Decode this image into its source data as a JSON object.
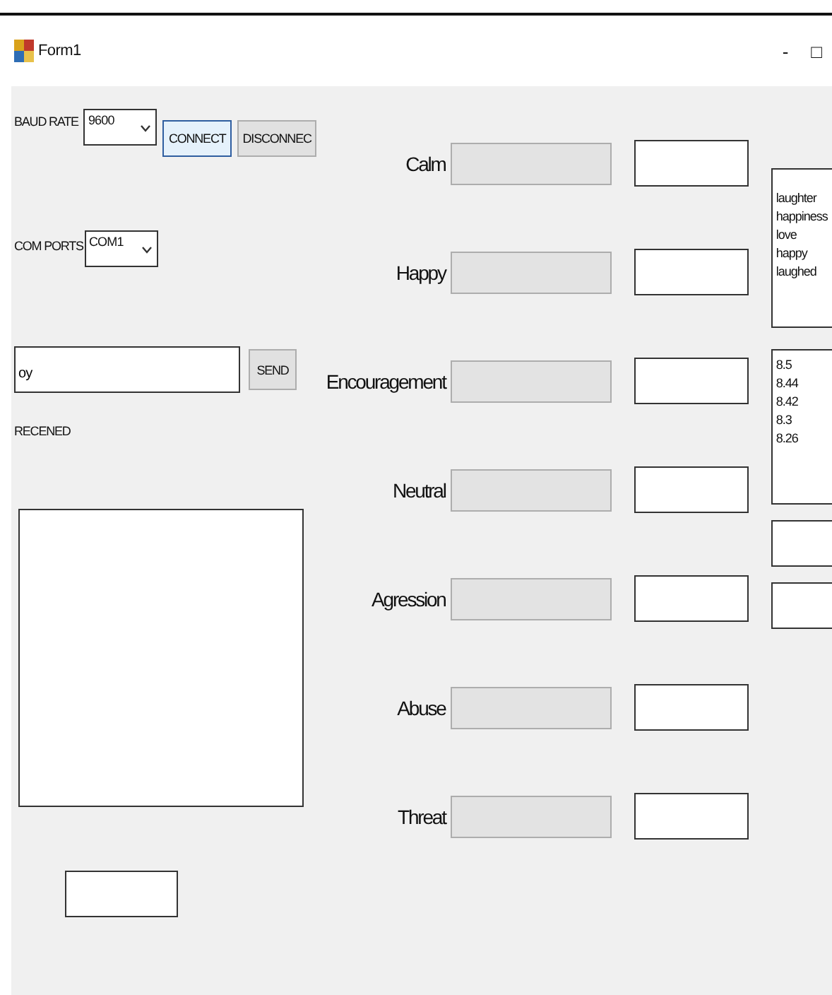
{
  "window": {
    "title": "Form1",
    "minimize": "-",
    "maximize": "□"
  },
  "baud_rate": {
    "label": "BAUD RATE",
    "value": "9600"
  },
  "buttons": {
    "connect": "CONNECT",
    "disconnect": "DISCONNEC"
  },
  "com_ports": {
    "label": "COM PORTS",
    "value": "COM1"
  },
  "send": {
    "value": "oy",
    "button": "SEND"
  },
  "received": {
    "label": "RECENED"
  },
  "emotions": [
    {
      "label": "Calm"
    },
    {
      "label": "Happy"
    },
    {
      "label": "Encouragement"
    },
    {
      "label": "Neutral"
    },
    {
      "label": "Agression"
    },
    {
      "label": "Abuse"
    },
    {
      "label": "Threat"
    }
  ],
  "keywords": [
    "laughter",
    "happiness",
    "love",
    "happy",
    "laughed"
  ],
  "scores": [
    "8.5",
    "8.44",
    "8.42",
    "8.3",
    "8.26"
  ]
}
